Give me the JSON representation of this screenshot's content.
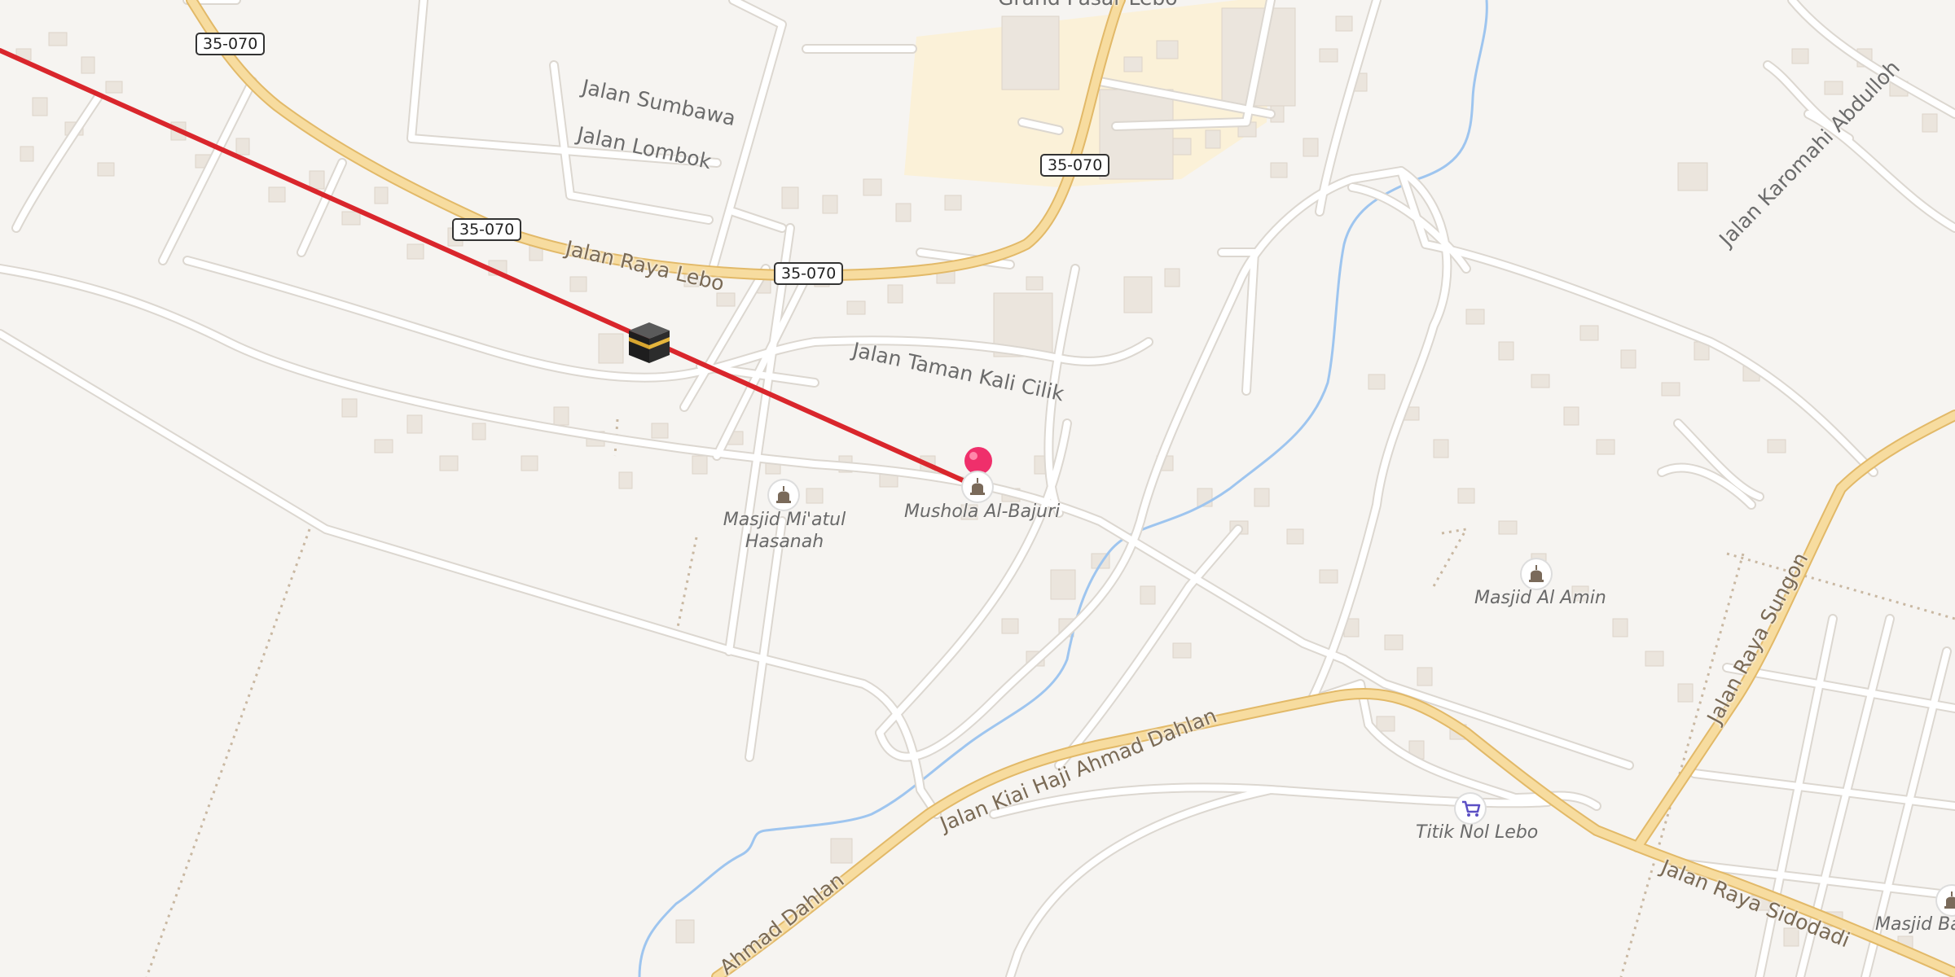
{
  "route_shields": [
    "35-070",
    "35-070",
    "35-070",
    "35-070"
  ],
  "streets": {
    "sumbawa": "Jalan Sumbawa",
    "lombok": "Jalan Lombok",
    "raya_lebo": "Jalan Raya Lebo",
    "taman_kali_cilik": "Jalan Taman Kali Cilik",
    "karomahi": "Jalan Karomahi Abdulloh",
    "raya_sungon": "Jalan Raya Sungon",
    "ahmad_dahlan": "Jalan Kiai Haji Ahmad Dahlan",
    "ahmad_dahlan_short": "Ahmad Dahlan",
    "raya_sidodadi": "Jalan Raya Sidodadi"
  },
  "places": {
    "top_cut": "Grand Pasar Lebo",
    "masjid_miatul_1": "Masjid Mi'atul",
    "masjid_miatul_2": "Hasanah",
    "mushola": "Mushola Al-Bajuri",
    "masjid_al_amin": "Masjid Al Amin",
    "titik_nol": "Titik Nol Lebo",
    "masjid_right": "Masjid Ba"
  },
  "icons": {
    "kaaba": "kaaba-icon",
    "pin": "location-pin-icon",
    "mosque": "mosque-icon",
    "cart": "shopping-cart-icon"
  },
  "colors": {
    "background": "#f6f4f1",
    "major_road": "#f3d18c",
    "minor_road": "#ffffff",
    "river": "#9ec5ef",
    "qibla_line": "#d9262c",
    "pin": "#ef2f6b",
    "building": "#ebe5dd"
  }
}
